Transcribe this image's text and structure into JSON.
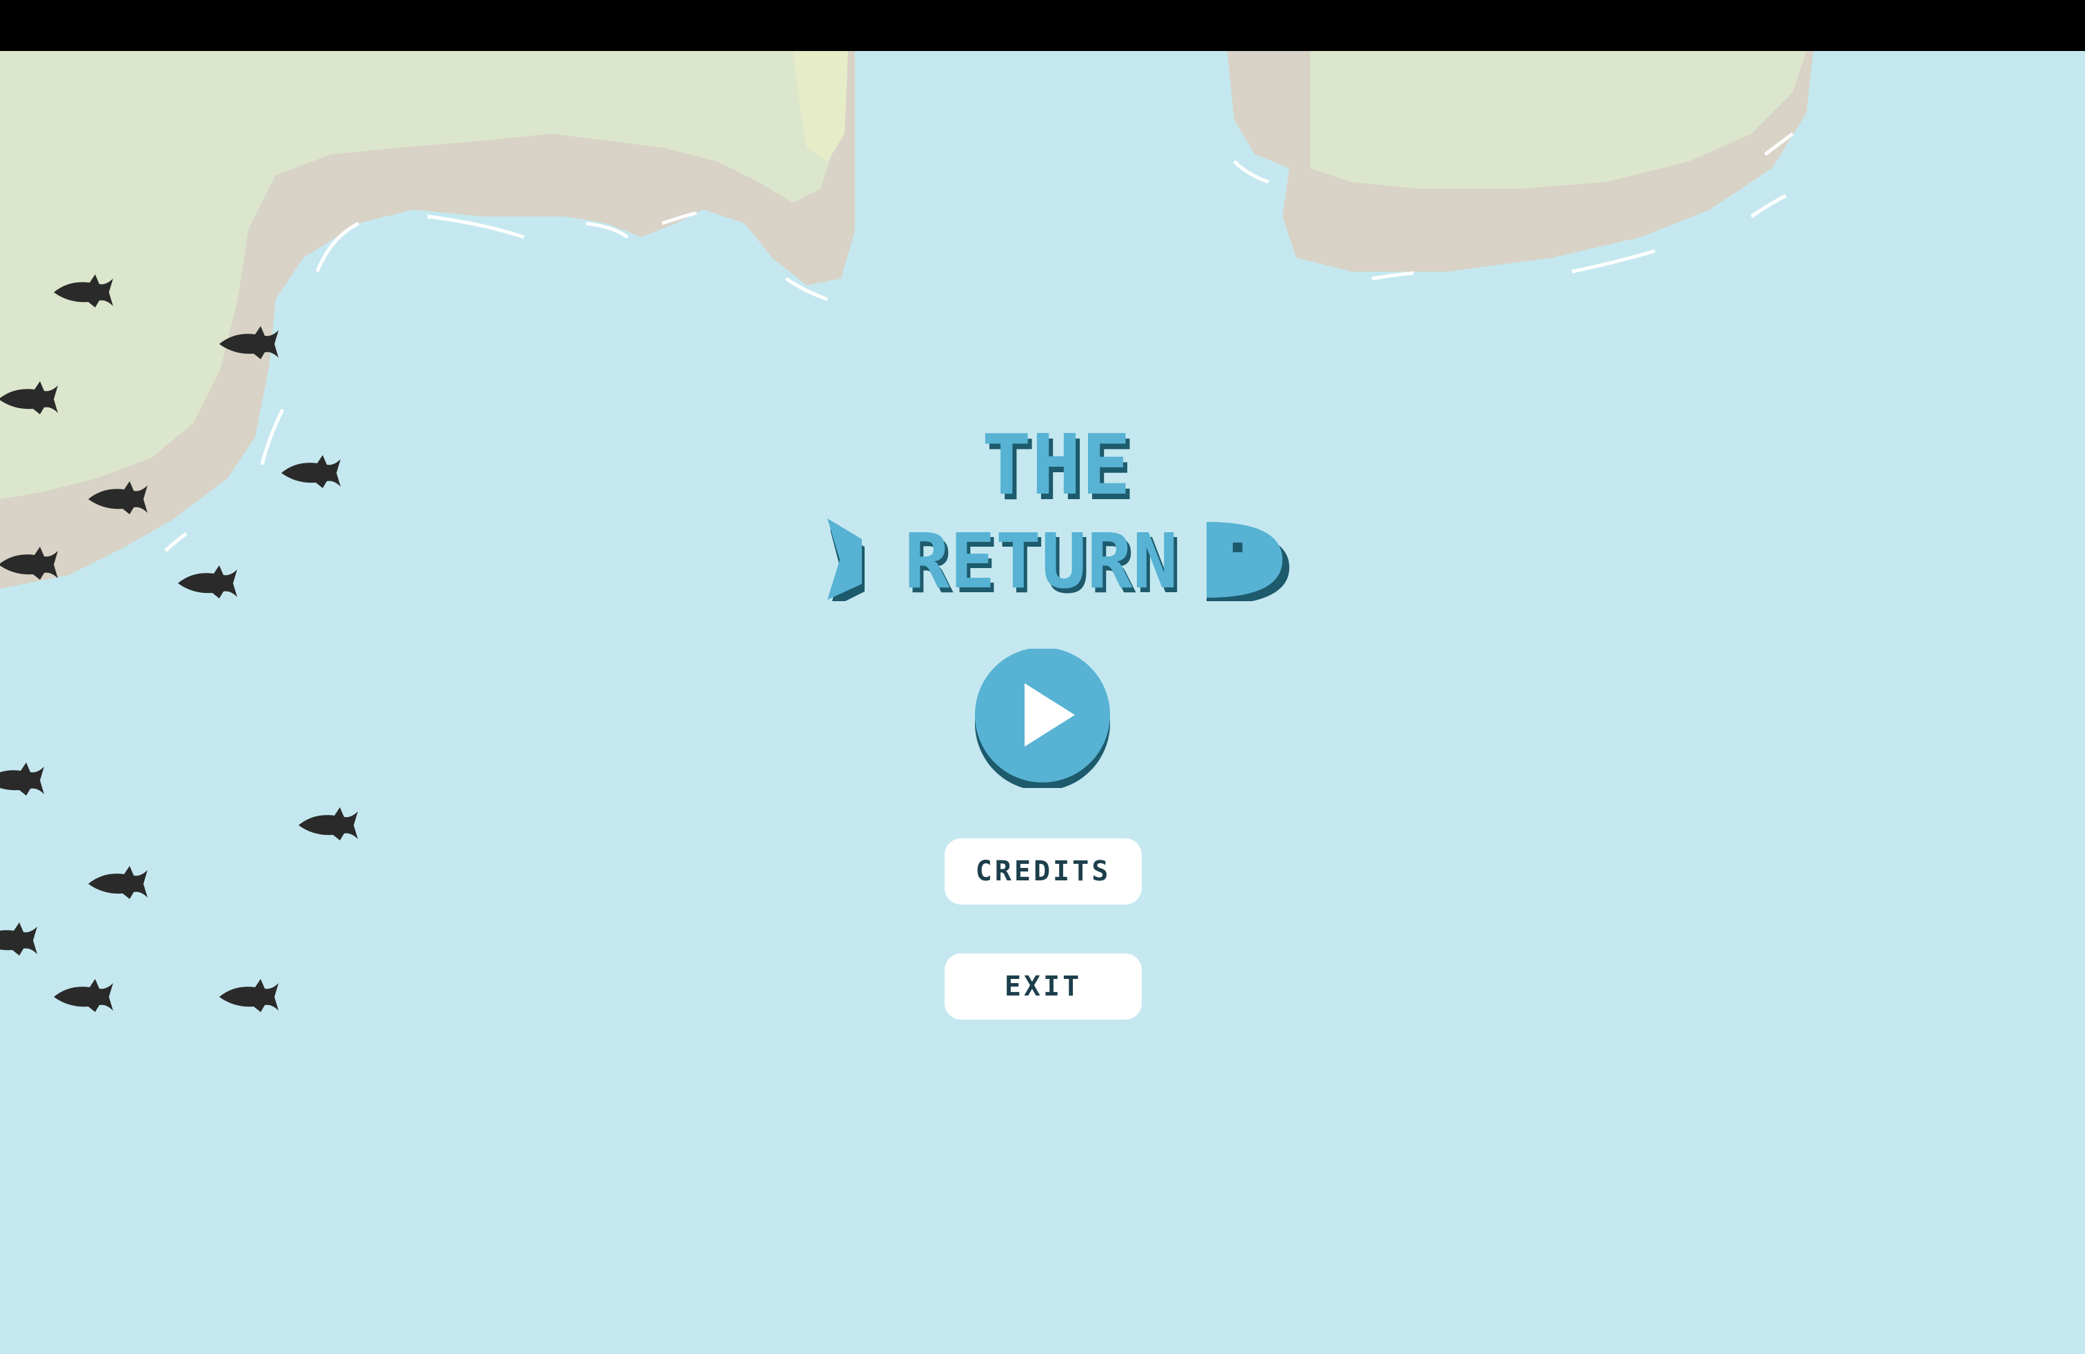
{
  "game": {
    "title_line1": "THE",
    "title_line2": "RETURN"
  },
  "menu": {
    "play_icon": "play-icon",
    "credits_label": "CREDITS",
    "exit_label": "EXIT"
  },
  "colors": {
    "sea": "#c5e8f0",
    "land": "#dce6cc",
    "cliff": "#d8d3c6",
    "title": "#57b2d3",
    "title_shadow": "#1d5a6c",
    "button_bg": "#ffffff",
    "button_text": "#1d3f4c",
    "fish": "#2a2a2a"
  }
}
